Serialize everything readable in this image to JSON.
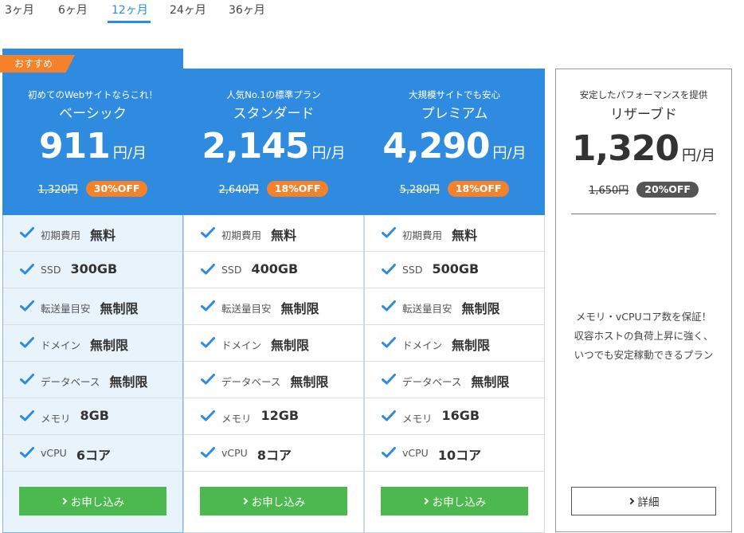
{
  "tabs": [
    "3ヶ月",
    "6ヶ月",
    "12ヶ月",
    "24ヶ月",
    "36ヶ月"
  ],
  "active_tab": "12ヶ月",
  "colors": {
    "accent": "#2f8be0",
    "badge": "#f5812b",
    "apply": "#4cb94e",
    "reserve_badge": "#555555"
  },
  "ribbon": "おすすめ",
  "plans": [
    {
      "catch": "初めてのWebサイトならこれ！",
      "name": "ベーシック",
      "price": "911",
      "unit": "円/月",
      "old_price": "1,320円",
      "discount": "30%OFF",
      "features": [
        {
          "label": "初期費用",
          "value": "無料"
        },
        {
          "label": "SSD",
          "value": "300GB"
        },
        {
          "label": "転送量目安",
          "value": "無制限"
        },
        {
          "label": "ドメイン",
          "value": "無制限"
        },
        {
          "label": "データベース",
          "value": "無制限"
        },
        {
          "label": "メモリ",
          "value": "8GB"
        },
        {
          "label": "vCPU",
          "value": "6コア"
        }
      ],
      "button": "お申し込み"
    },
    {
      "catch": "人気No.1の標準プラン",
      "name": "スタンダード",
      "price": "2,145",
      "unit": "円/月",
      "old_price": "2,640円",
      "discount": "18%OFF",
      "features": [
        {
          "label": "初期費用",
          "value": "無料"
        },
        {
          "label": "SSD",
          "value": "400GB"
        },
        {
          "label": "転送量目安",
          "value": "無制限"
        },
        {
          "label": "ドメイン",
          "value": "無制限"
        },
        {
          "label": "データベース",
          "value": "無制限"
        },
        {
          "label": "メモリ",
          "value": "12GB"
        },
        {
          "label": "vCPU",
          "value": "8コア"
        }
      ],
      "button": "お申し込み"
    },
    {
      "catch": "大規模サイトでも安心",
      "name": "プレミアム",
      "price": "4,290",
      "unit": "円/月",
      "old_price": "5,280円",
      "discount": "18%OFF",
      "features": [
        {
          "label": "初期費用",
          "value": "無料"
        },
        {
          "label": "SSD",
          "value": "500GB"
        },
        {
          "label": "転送量目安",
          "value": "無制限"
        },
        {
          "label": "ドメイン",
          "value": "無制限"
        },
        {
          "label": "データベース",
          "value": "無制限"
        },
        {
          "label": "メモリ",
          "value": "16GB"
        },
        {
          "label": "vCPU",
          "value": "10コア"
        }
      ],
      "button": "お申し込み"
    }
  ],
  "reserve": {
    "catch": "安定したパフォーマンスを提供",
    "name": "リザーブド",
    "price": "1,320",
    "unit": "円/月",
    "old_price": "1,650円",
    "discount": "20%OFF",
    "description": "メモリ・vCPUコア数を保証！収容ホストの負荷上昇に強く、いつでも安定稼動できるプラン",
    "button": "詳細"
  }
}
